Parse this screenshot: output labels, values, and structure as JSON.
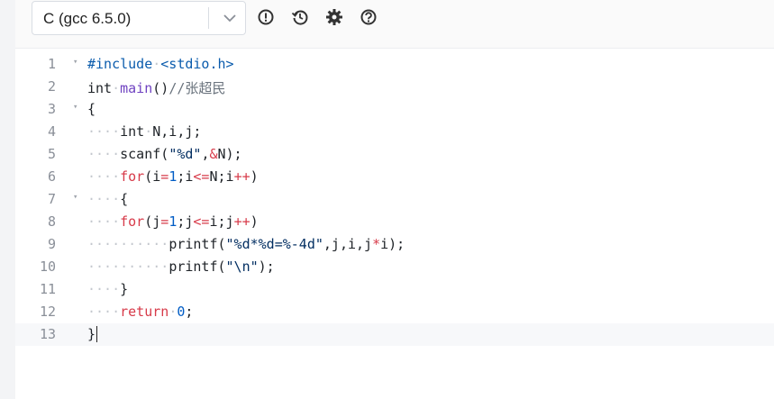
{
  "toolbar": {
    "language": "C (gcc 6.5.0)",
    "icons": [
      "alert-icon",
      "history-icon",
      "settings-icon",
      "help-icon"
    ]
  },
  "editor": {
    "lines": [
      {
        "n": "1",
        "fold": "▾"
      },
      {
        "n": "2",
        "fold": ""
      },
      {
        "n": "3",
        "fold": "▾"
      },
      {
        "n": "4",
        "fold": ""
      },
      {
        "n": "5",
        "fold": ""
      },
      {
        "n": "6",
        "fold": ""
      },
      {
        "n": "7",
        "fold": "▾"
      },
      {
        "n": "8",
        "fold": ""
      },
      {
        "n": "9",
        "fold": ""
      },
      {
        "n": "10",
        "fold": ""
      },
      {
        "n": "11",
        "fold": ""
      },
      {
        "n": "12",
        "fold": ""
      },
      {
        "n": "13",
        "fold": ""
      }
    ],
    "tokens": {
      "l1_a": "#include",
      "l1_b": "<stdio.h>",
      "l2_a": "int",
      "l2_b": "main",
      "l2_c": "()",
      "l2_d": "//张超民",
      "l3_a": "{",
      "l4_a": "int",
      "l4_b": "N,i,j;",
      "l5_a": "scanf(",
      "l5_b": "\"%d\"",
      "l5_c": ",",
      "l5_d": "&",
      "l5_e": "N);",
      "l6_a": "for",
      "l6_b": "(i",
      "l6_c": "=",
      "l6_d": "1",
      "l6_e": ";i",
      "l6_f": "<=",
      "l6_g": "N;i",
      "l6_h": "++",
      "l6_i": ")",
      "l7_a": "{",
      "l8_a": "for",
      "l8_b": "(j",
      "l8_c": "=",
      "l8_d": "1",
      "l8_e": ";j",
      "l8_f": "<=",
      "l8_g": "i;j",
      "l8_h": "++",
      "l8_i": ")",
      "l9_a": "printf(",
      "l9_b": "\"%d*%d=%-4d\"",
      "l9_c": ",j,i,j",
      "l9_d": "*",
      "l9_e": "i);",
      "l10_a": "printf(",
      "l10_b": "\"\\n\"",
      "l10_c": ");",
      "l11_a": "}",
      "l12_a": "return",
      "l12_b": "0",
      "l12_c": ";",
      "l13_a": "}"
    }
  }
}
